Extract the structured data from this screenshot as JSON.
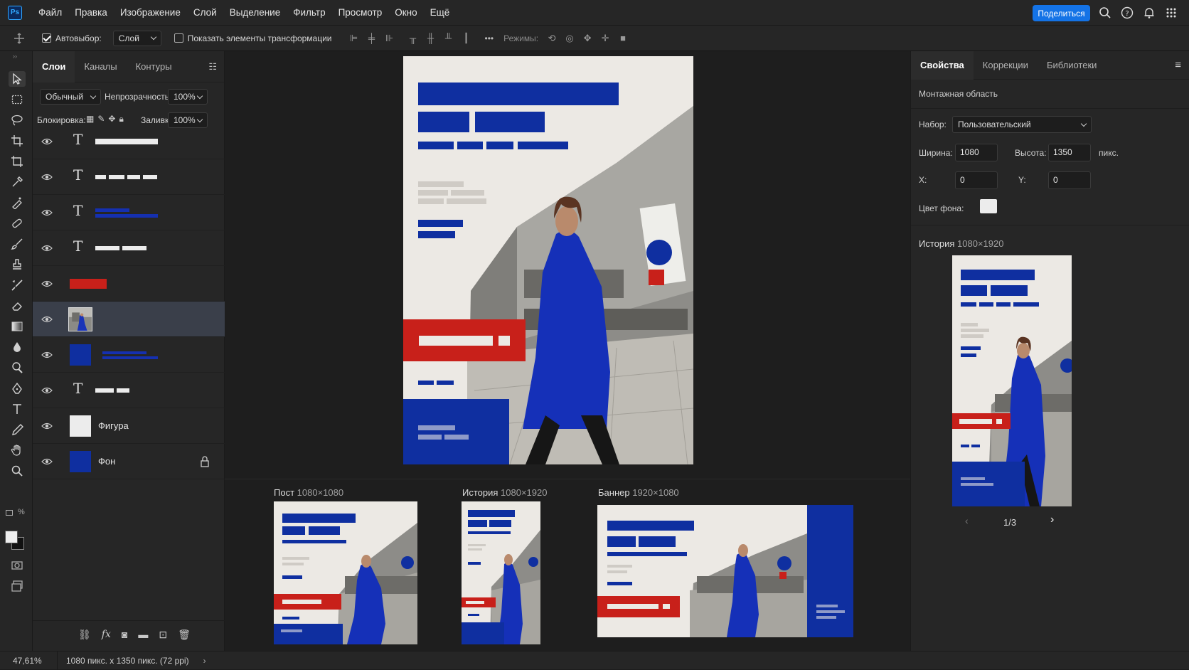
{
  "app": {
    "logo": "Ps",
    "accent": "#1473e6"
  },
  "menu": [
    "Файл",
    "Правка",
    "Изображение",
    "Слой",
    "Выделение",
    "Фильтр",
    "Просмотр",
    "Окно",
    "Ещё"
  ],
  "share_label": "Поделиться",
  "top_icons": [
    "search-icon",
    "help-icon",
    "bell-icon",
    "grid-apps-icon"
  ],
  "options": {
    "autoselect_label": "Автовыбор:",
    "autoselect_checked": true,
    "autoselect_value": "Слой",
    "show_transform_label": "Показать элементы трансформации",
    "show_transform_checked": false,
    "more": "•••",
    "modes_label": "Режимы:"
  },
  "layers_panel": {
    "tabs": [
      "Слои",
      "Каналы",
      "Контуры"
    ],
    "blend_mode": "Обычный",
    "opacity_label": "Непрозрачность:",
    "opacity_value": "100%",
    "lock_label": "Блокировка:",
    "fill_label": "Заливка:",
    "fill_value": "100%",
    "layers": [
      {
        "kind": "text",
        "name": ""
      },
      {
        "kind": "text",
        "name": ""
      },
      {
        "kind": "text",
        "name": ""
      },
      {
        "kind": "text",
        "name": ""
      },
      {
        "kind": "shape",
        "name": ""
      },
      {
        "kind": "image",
        "name": "",
        "selected": true
      },
      {
        "kind": "shape",
        "name": ""
      },
      {
        "kind": "text",
        "name": ""
      },
      {
        "kind": "shape",
        "name": "Фигура"
      },
      {
        "kind": "shape",
        "name": "Фон",
        "locked": true
      }
    ],
    "footer_icons": [
      "link-icon",
      "fx-icon",
      "mask-icon",
      "folder-icon",
      "new-layer-icon",
      "trash-icon"
    ]
  },
  "artboards": [
    {
      "label": "Пост",
      "size": "1080×1080"
    },
    {
      "label": "История",
      "size": "1080×1920"
    },
    {
      "label": "Баннер",
      "size": "1920×1080"
    }
  ],
  "properties": {
    "tabs": [
      "Свойства",
      "Коррекции",
      "Библиотеки"
    ],
    "section_title": "Монтажная область",
    "preset_label": "Набор:",
    "preset_value": "Пользовательский",
    "width_label": "Ширина:",
    "width_value": "1080",
    "height_label": "Высота:",
    "height_value": "1350",
    "unit": "пикс.",
    "x_label": "X:",
    "x_value": "0",
    "y_label": "Y:",
    "y_value": "0",
    "bg_label": "Цвет фона:",
    "bg_color": "#ececec",
    "history_label": "История",
    "history_size": "1080×1920",
    "pager": "1/3"
  },
  "status": {
    "zoom": "47,61%",
    "doc_info": "1080 пикс. x 1350 пикс. (72 ppi)"
  },
  "colors": {
    "blue": "#0f2fa0",
    "red": "#c8201a",
    "paper": "#ece9e4"
  }
}
